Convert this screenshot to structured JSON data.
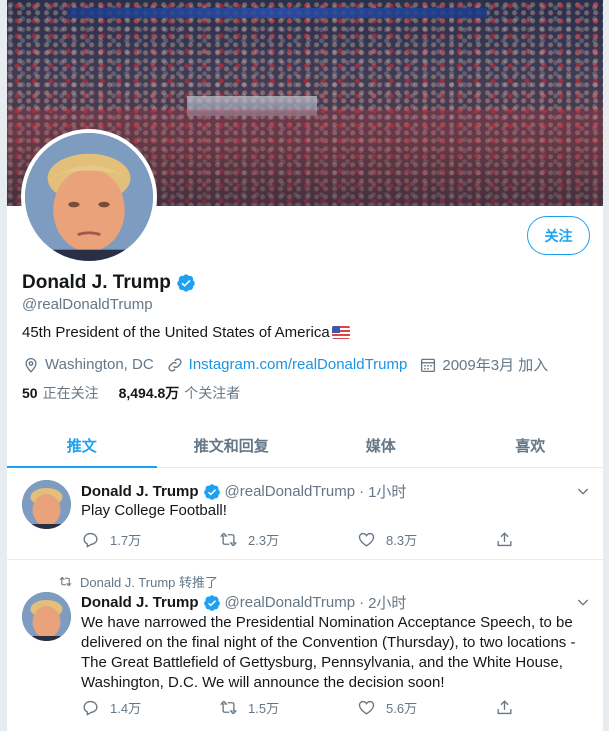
{
  "profile": {
    "name": "Donald J. Trump",
    "handle": "@realDonaldTrump",
    "bio": "45th President of the United States of America",
    "location": "Washington, DC",
    "website": "Instagram.com/realDonaldTrump",
    "joined": "2009年3月 加入",
    "following_count": "50",
    "following_label": "正在关注",
    "followers_count": "8,494.8万",
    "followers_label": "个关注者",
    "follow_button": "关注"
  },
  "tabs": [
    {
      "label": "推文",
      "active": true
    },
    {
      "label": "推文和回复",
      "active": false
    },
    {
      "label": "媒体",
      "active": false
    },
    {
      "label": "喜欢",
      "active": false
    }
  ],
  "tweets": [
    {
      "retweet_label": "",
      "name": "Donald J. Trump",
      "handle": "@realDonaldTrump",
      "dot": "·",
      "time": "1小时",
      "text": "Play College Football!",
      "replies": "1.7万",
      "retweets": "2.3万",
      "likes": "8.3万"
    },
    {
      "retweet_label": "Donald J. Trump 转推了",
      "name": "Donald J. Trump",
      "handle": "@realDonaldTrump",
      "dot": "·",
      "time": "2小时",
      "text": "We have narrowed the Presidential Nomination Acceptance Speech, to be delivered on the final night of the Convention (Thursday), to two locations - The Great Battlefield of Gettysburg, Pennsylvania, and the White House, Washington, D.C. We will announce the decision soon!",
      "replies": "1.4万",
      "retweets": "1.5万",
      "likes": "5.6万"
    }
  ],
  "colors": {
    "accent": "#1da1f2",
    "link": "#1b95e0",
    "secondary_text": "#657786",
    "border": "#e6ecf0"
  }
}
